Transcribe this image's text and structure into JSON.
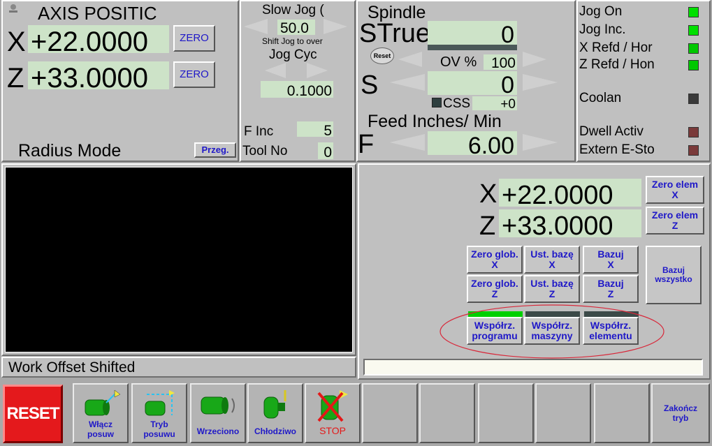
{
  "axis_panel": {
    "title": "AXIS POSITIC",
    "x_label": "X",
    "x_value": "+22.0000",
    "z_label": "Z",
    "z_value": "+33.0000",
    "zero_label": "ZERO",
    "mode_label": "Radius Mode",
    "przeg_label": "Przeg."
  },
  "jog_panel": {
    "slow_jog_label": "Slow Jog (",
    "slow_jog_value": "50.0",
    "shift_hint": "Shift Jog to over",
    "jog_cyc_label": "Jog Cyc",
    "jog_cyc_value": "0.1000",
    "f_inc_label": "F Inc",
    "f_inc_value": "5",
    "tool_label": "Tool No",
    "tool_value": "0"
  },
  "spindle_panel": {
    "title": "Spindle",
    "true_label": "STrue",
    "true_value": "0",
    "reset_label": "Reset",
    "ov_label": "OV %",
    "ov_value": "100",
    "s_label": "S",
    "s_value": "0",
    "css_label": "CSS",
    "css_value": "+0",
    "feed_label": "Feed Inches/ Min",
    "f_label": "F",
    "f_value": "6.00"
  },
  "status_panel": {
    "items": [
      {
        "label": "Jog On",
        "color": "#00e000"
      },
      {
        "label": "Jog Inc.",
        "color": "#00e000"
      },
      {
        "label": "X Refd / Hor",
        "color": "#00c800"
      },
      {
        "label": "Z Refd / Hon",
        "color": "#00c800"
      },
      {
        "label": "Coolan",
        "color": "#3a3a3a"
      },
      {
        "label": "Dwell Activ",
        "color": "#7a3a3a"
      },
      {
        "label": "Extern E-Sto",
        "color": "#7a3a3a"
      }
    ]
  },
  "work_offset_label": "Work Offset Shifted",
  "coord_panel": {
    "x_label": "X",
    "x_value": "+22.0000",
    "z_label": "Z",
    "z_value": "+33.0000",
    "zero_elem_x": [
      "Zero elem",
      "X"
    ],
    "zero_elem_z": [
      "Zero elem",
      "Z"
    ],
    "zero_glob_x": [
      "Zero glob.",
      "X"
    ],
    "ust_baze_x": [
      "Ust. bazę",
      "X"
    ],
    "bazuj_x": [
      "Bazuj",
      "X"
    ],
    "bazuj_all": [
      "Bazuj",
      "wszystko"
    ],
    "zero_glob_z": [
      "Zero glob.",
      "Z"
    ],
    "ust_baze_z": [
      "Ust. bazę",
      "Z"
    ],
    "bazuj_z": [
      "Bazuj",
      "Z"
    ],
    "wsp_prog": [
      "Współrz.",
      "programu"
    ],
    "wsp_masz": [
      "Współrz.",
      "maszyny"
    ],
    "wsp_elem": [
      "Współrz.",
      "elementu"
    ],
    "active_color": "#00d000",
    "inactive_color": "#3c4a48"
  },
  "bottom_bar": {
    "reset_label": "RESET",
    "wlacz": [
      "Włącz",
      "posuw"
    ],
    "tryb": [
      "Tryb",
      "posuwu"
    ],
    "wrzeciono": "Wrzeciono",
    "chlodziwo": "Chłodziwo",
    "stop": "STOP",
    "zakoncz": [
      "Zakończ",
      "tryb"
    ],
    "reset_color": "#e4191c"
  }
}
